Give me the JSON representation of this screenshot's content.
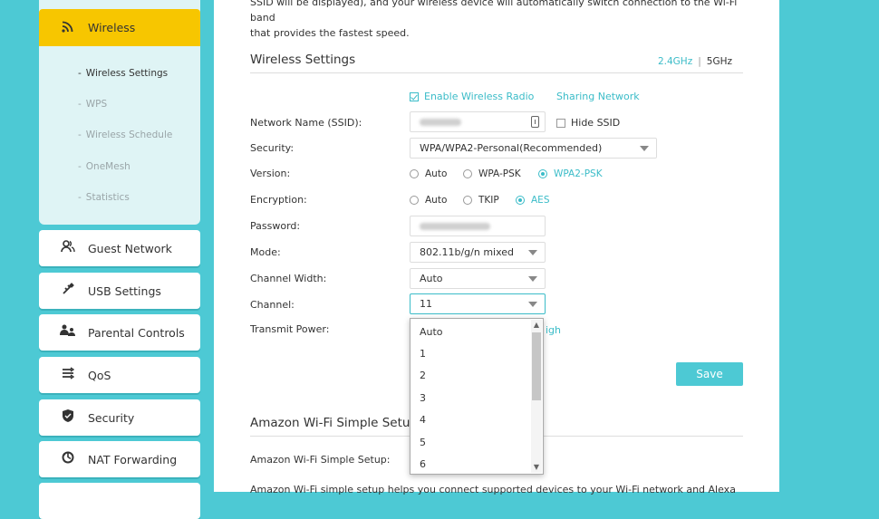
{
  "sidebar": {
    "active": {
      "label": "Wireless",
      "icon": "wireless-icon"
    },
    "subitems": [
      {
        "label": "Wireless Settings",
        "current": true
      },
      {
        "label": "WPS"
      },
      {
        "label": "Wireless Schedule"
      },
      {
        "label": "OneMesh"
      },
      {
        "label": "Statistics"
      }
    ],
    "items": [
      {
        "label": "Guest Network",
        "icon": "guest-network-icon"
      },
      {
        "label": "USB Settings",
        "icon": "usb-icon"
      },
      {
        "label": "Parental Controls",
        "icon": "parental-controls-icon"
      },
      {
        "label": "QoS",
        "icon": "qos-icon"
      },
      {
        "label": "Security",
        "icon": "shield-icon"
      },
      {
        "label": "NAT Forwarding",
        "icon": "nat-forwarding-icon"
      }
    ]
  },
  "main": {
    "top_text_line1": "SSID will be displayed), and your wireless device will automatically switch connection to the Wi-Fi band",
    "top_text_line2": "that provides the fastest speed.",
    "section_title": "Wireless Settings",
    "band_24": "2.4GHz",
    "band_sep": "|",
    "band_5": "5GHz",
    "enable_radio": "Enable Wireless Radio",
    "sharing_network": "Sharing Network",
    "ssid_label": "Network Name (SSID):",
    "hide_ssid": "Hide SSID",
    "security_label": "Security:",
    "security_value": "WPA/WPA2-Personal(Recommended)",
    "version_label": "Version:",
    "version_options": [
      "Auto",
      "WPA-PSK",
      "WPA2-PSK"
    ],
    "encryption_label": "Encryption:",
    "encryption_options": [
      "Auto",
      "TKIP",
      "AES"
    ],
    "password_label": "Password:",
    "mode_label": "Mode:",
    "mode_value": "802.11b/g/n mixed",
    "channel_width_label": "Channel Width:",
    "channel_width_value": "Auto",
    "channel_label": "Channel:",
    "channel_value": "11",
    "transmit_power_label": "Transmit Power:",
    "transmit_power_partial": "igh",
    "save_label": "Save",
    "amazon_title": "Amazon Wi-Fi Simple Setu",
    "amazon_label": "Amazon Wi-Fi Simple Setup:",
    "amazon_desc": "Amazon Wi-Fi simple setup helps you connect supported devices to your Wi-Fi network and Alexa"
  },
  "dropdown": {
    "options": [
      "Auto",
      "1",
      "2",
      "3",
      "4",
      "5",
      "6"
    ]
  },
  "colors": {
    "accent": "#4dc9d4",
    "link": "#3bbcc8",
    "active_nav": "#f7c600"
  }
}
